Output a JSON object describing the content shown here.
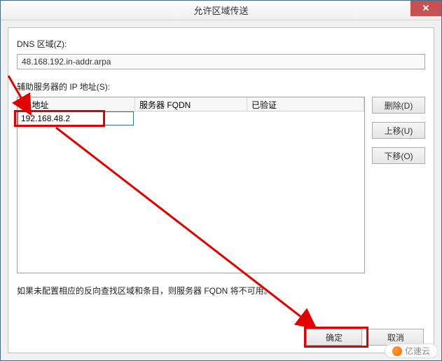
{
  "window": {
    "title": "允许区域传送",
    "close_glyph": "✕"
  },
  "dns_zone": {
    "label": "DNS 区域(Z):",
    "value": "48.168.192.in-addr.arpa"
  },
  "aux_label": "辅助服务器的 IP 地址(S):",
  "list": {
    "columns": {
      "ip": "IP 地址",
      "fqdn": "服务器 FQDN",
      "verified": "已验证"
    },
    "editing_value": "192.168.48.2"
  },
  "side_buttons": {
    "delete": "删除(D)",
    "move_up": "上移(U)",
    "move_down": "下移(O)"
  },
  "note": "如果未配置相应的反向查找区域和条目，则服务器 FQDN 将不可用。",
  "dialog_buttons": {
    "ok": "确定",
    "cancel": "取消"
  },
  "watermark": "亿速云"
}
